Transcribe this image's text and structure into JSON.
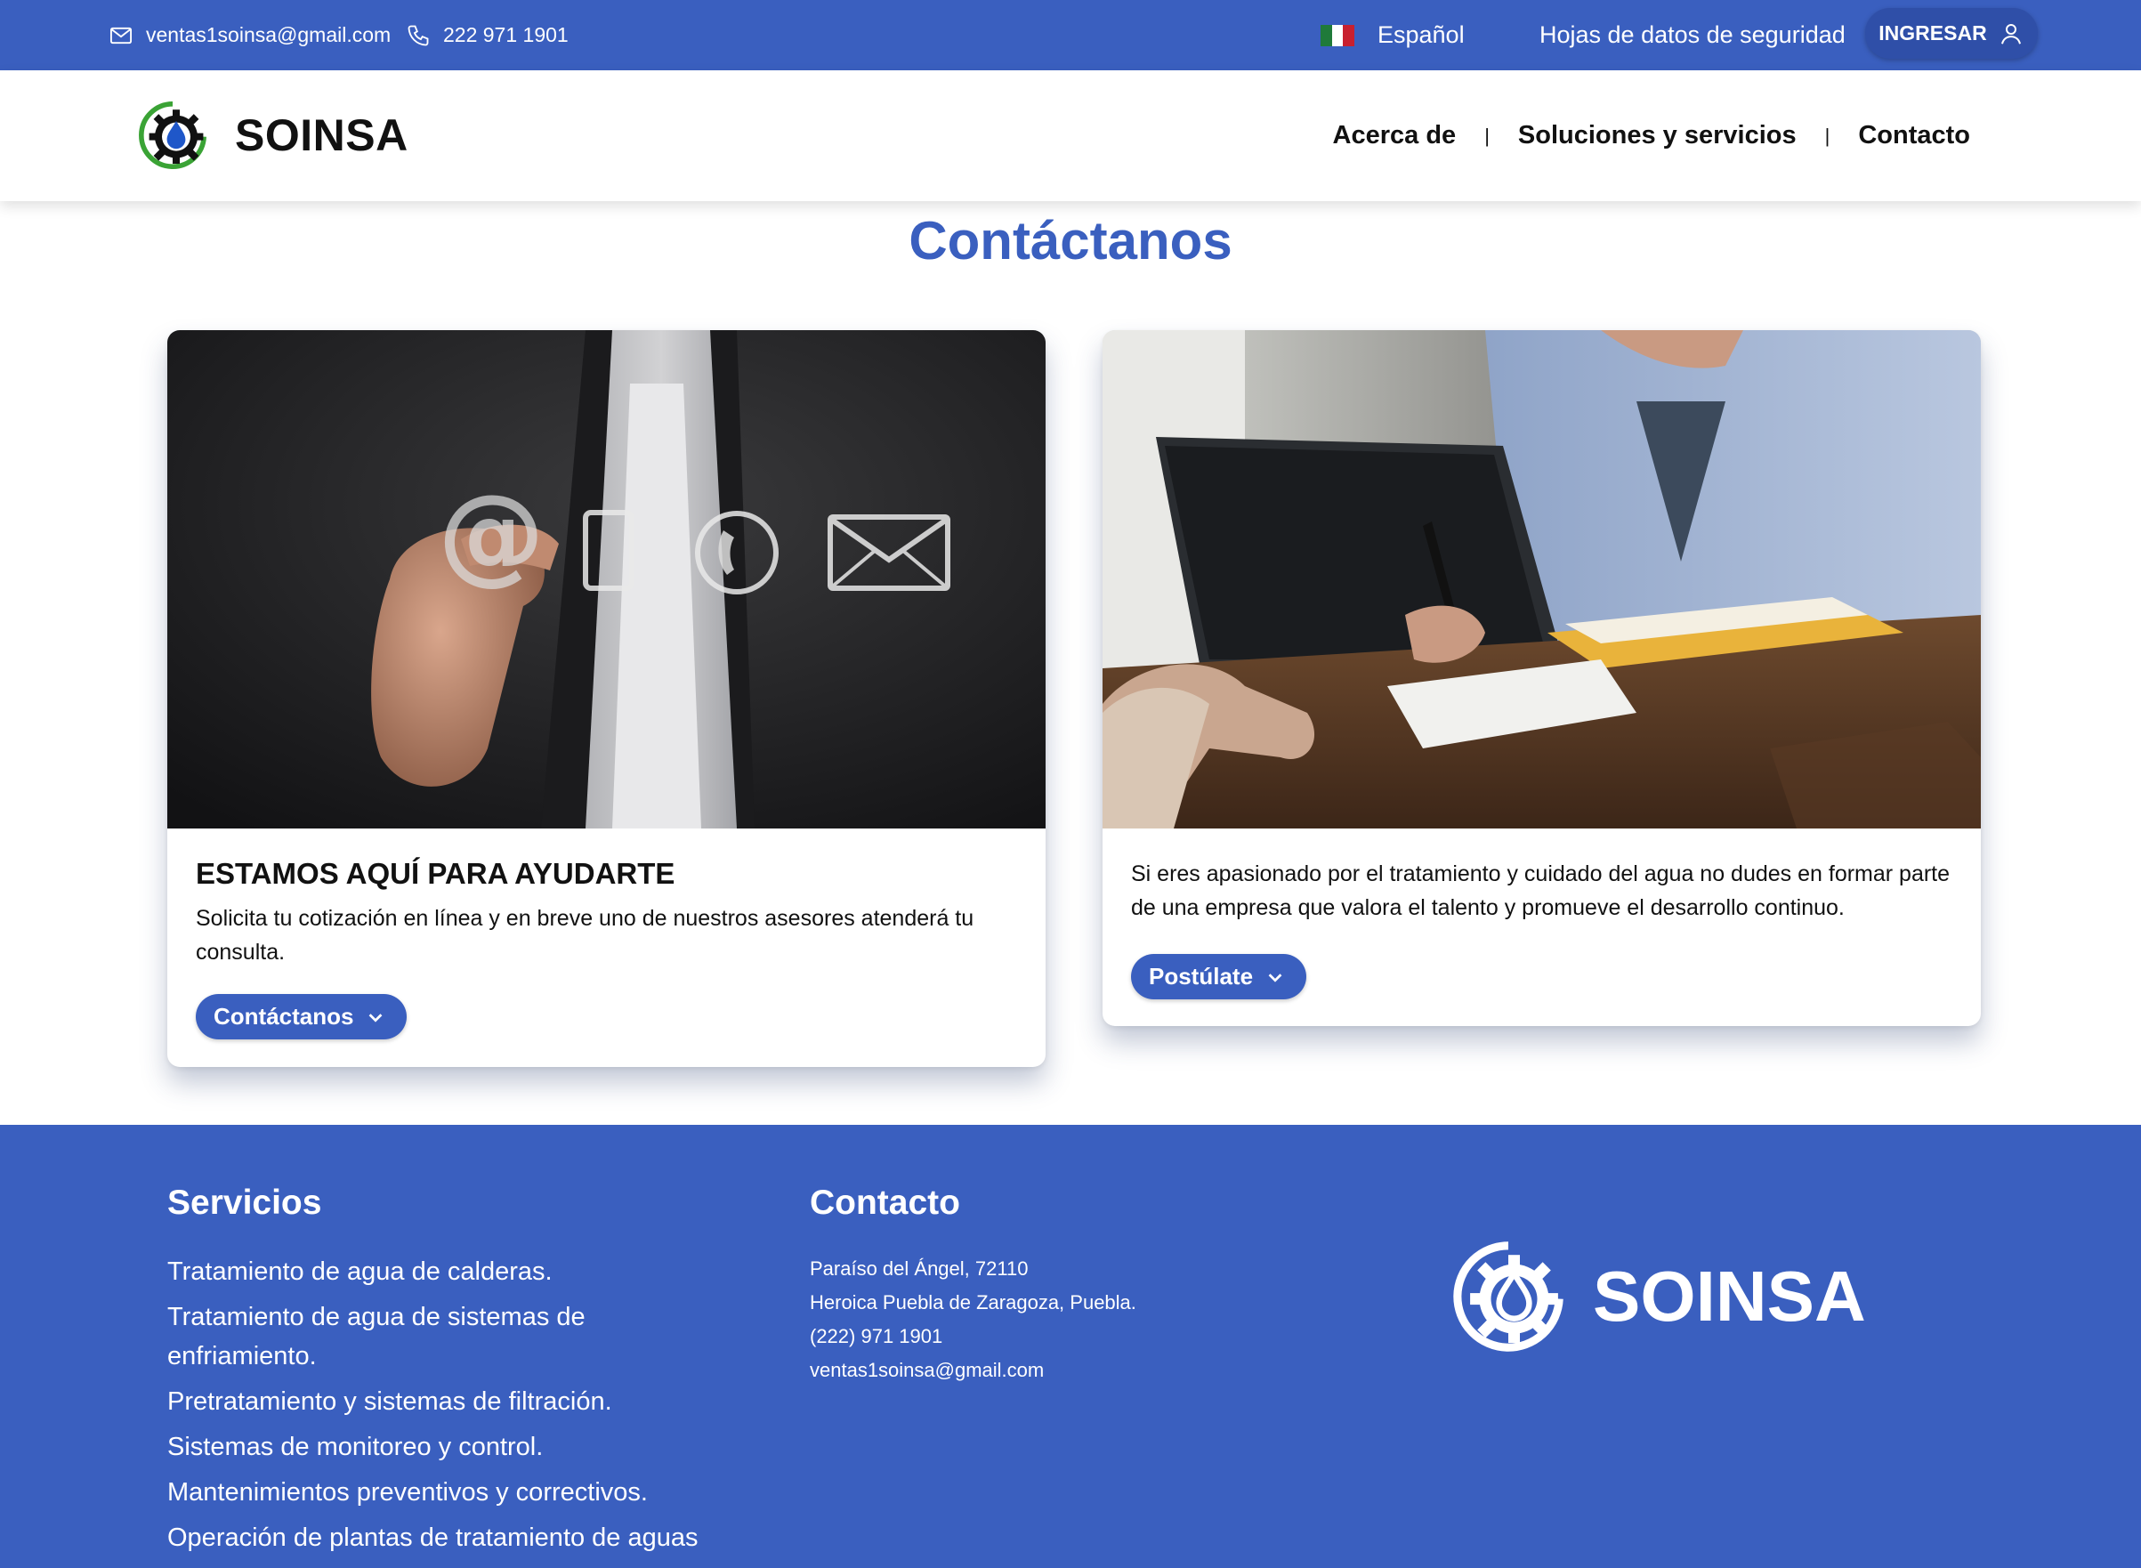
{
  "topbar": {
    "email": "ventas1soinsa@gmail.com",
    "phone": "222 971 1901",
    "language": "Español",
    "safety_sheets": "Hojas de datos de seguridad",
    "login": "INGRESAR"
  },
  "header": {
    "brand": "SOINSA",
    "nav": [
      {
        "label": "Acerca de"
      },
      {
        "label": "Soluciones y servicios"
      },
      {
        "label": "Contacto"
      }
    ]
  },
  "main": {
    "title": "Contáctanos",
    "cards": [
      {
        "title": "ESTAMOS AQUÍ PARA AYUDARTE",
        "text": "Solicita tu cotización en línea y en breve uno de nuestros asesores atenderá tu consulta.",
        "button": "Contáctanos"
      },
      {
        "title": "",
        "text": "Si eres apasionado por el tratamiento y cuidado del agua no dudes en formar parte de una empresa que valora el talento y promueve el desarrollo continuo.",
        "button": "Postúlate"
      }
    ]
  },
  "footer": {
    "services_title": "Servicios",
    "services": [
      "Tratamiento de agua de calderas.",
      "Tratamiento de agua de sistemas de enfriamiento.",
      "Pretratamiento y sistemas de filtración.",
      "Sistemas de monitoreo y control.",
      "Mantenimientos preventivos y correctivos.",
      "Operación de plantas de tratamiento de aguas"
    ],
    "contact_title": "Contacto",
    "contact_lines": [
      "Paraíso del Ángel, 72110",
      "Heroica Puebla de Zaragoza, Puebla.",
      "(222) 971 1901",
      "ventas1soinsa@gmail.com"
    ],
    "brand": "SOINSA"
  },
  "colors": {
    "primary": "#3a5fbf",
    "primary_dark": "#2f4fa8",
    "logo_green": "#3aa335",
    "logo_blue": "#1f57c9"
  }
}
